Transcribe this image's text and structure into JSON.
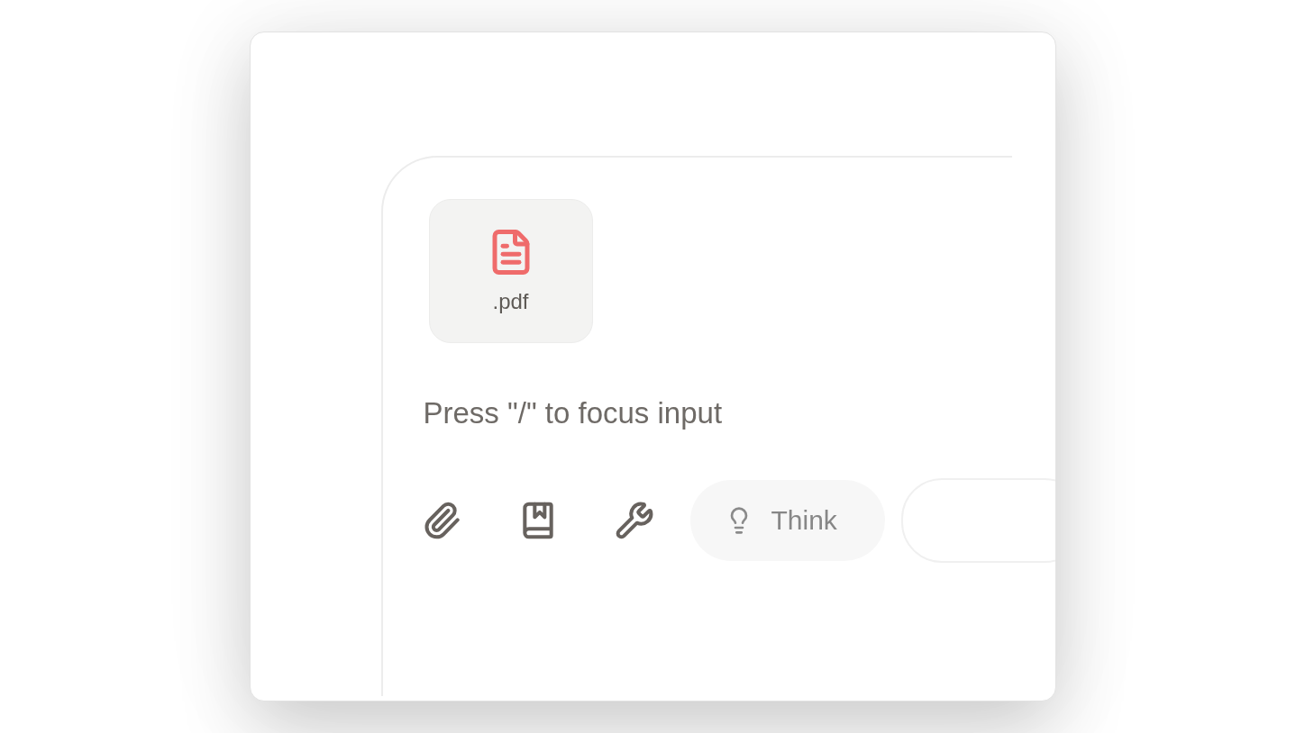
{
  "attachment": {
    "label": ".pdf"
  },
  "input": {
    "placeholder": "Press \"/\" to focus input"
  },
  "toolbar": {
    "think": {
      "label": "Think"
    }
  }
}
